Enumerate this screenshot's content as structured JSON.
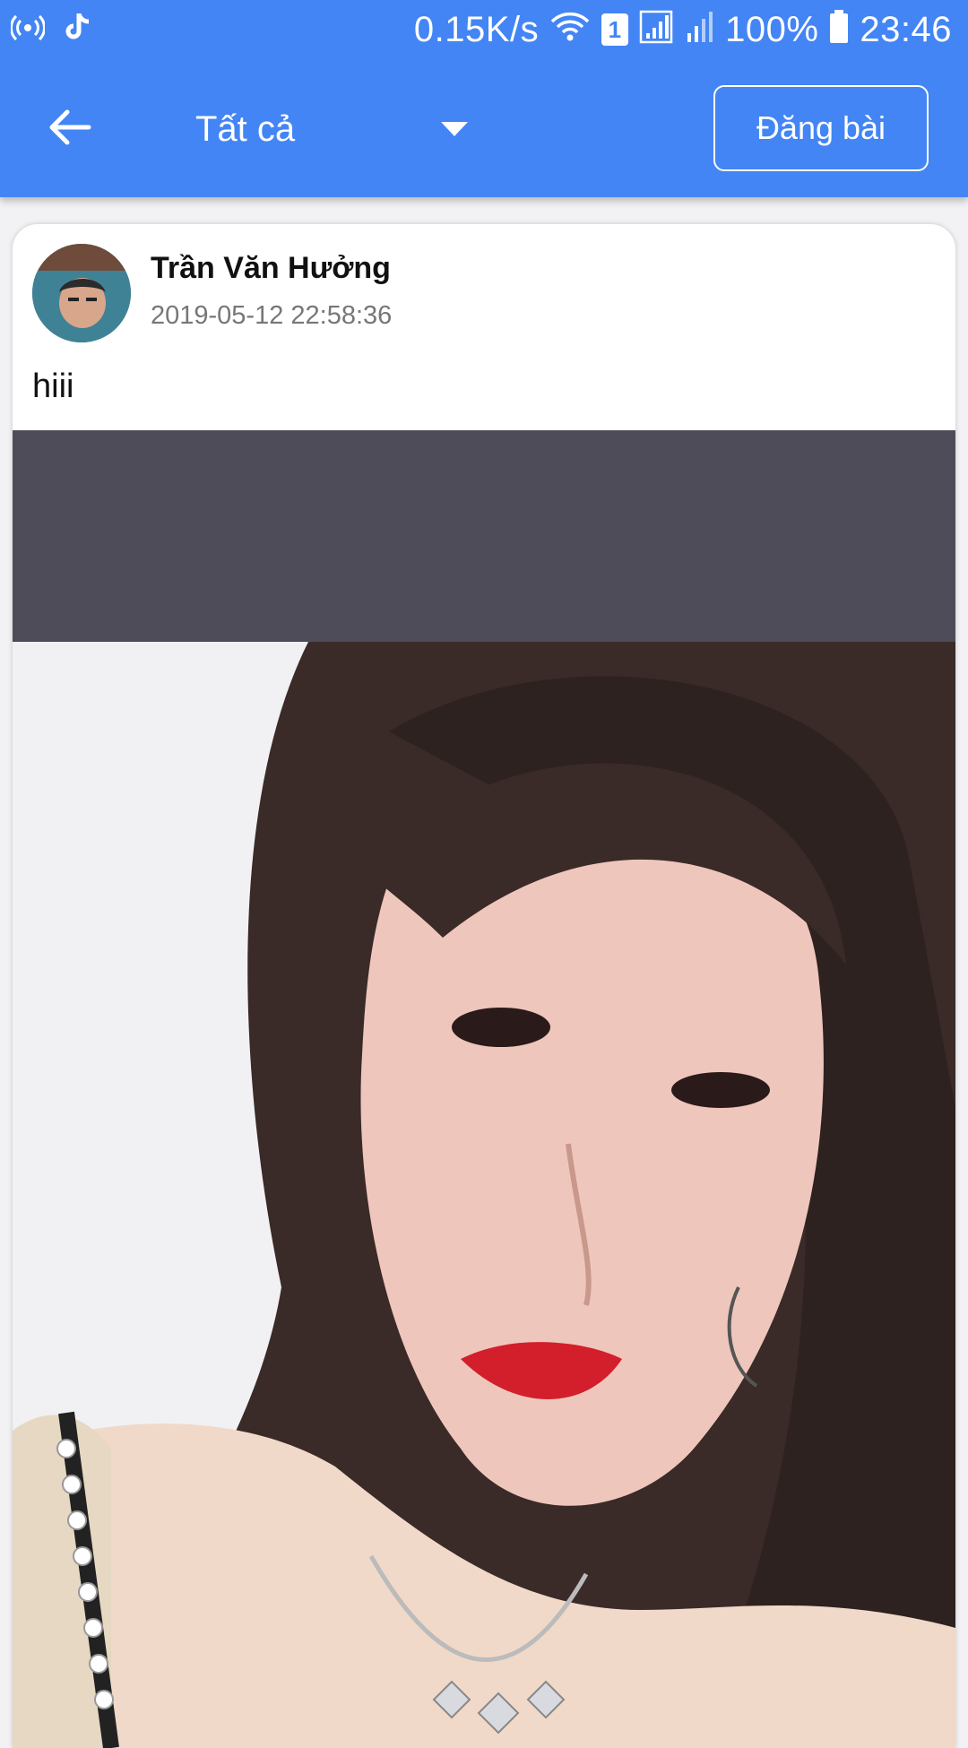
{
  "status_bar": {
    "net_speed": "0.15K/s",
    "sim_badge": "1",
    "battery": "100%",
    "time": "23:46",
    "icons": [
      "hotspot-icon",
      "tiktok-icon",
      "wifi-icon",
      "sim-icon",
      "signal-icon",
      "signal-icon",
      "battery-icon"
    ]
  },
  "toolbar": {
    "back_icon": "arrow-left-icon",
    "filter_label": "Tất cả",
    "filter_icon": "caret-down-icon",
    "post_button_label": "Đăng bài"
  },
  "post": {
    "author": "Trần Văn Hưởng",
    "timestamp": "2019-05-12 22:58:36",
    "text": "hiii",
    "avatar_icon": "user-avatar",
    "photo": "selfie-photo"
  },
  "colors": {
    "primary": "#4385f4",
    "card_bg": "#ffffff",
    "media_band": "#4d4c58",
    "muted_text": "#777777"
  }
}
